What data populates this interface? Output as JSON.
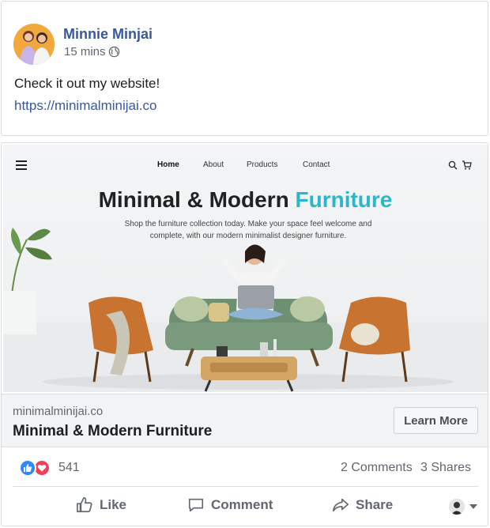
{
  "post": {
    "author": "Minnie Minjai",
    "time": "15 mins",
    "text": "Check it out my website!",
    "link": "https://minimalminijai.co"
  },
  "preview": {
    "nav": [
      "Home",
      "About",
      "Products",
      "Contact"
    ],
    "headline_main": "Minimal & Modern ",
    "headline_accent": "Furniture",
    "description": "Shop the furniture collection today. Make your space feel welcome and complete,  with our modern minimalist designer furniture.",
    "domain": "minimalminijai.co",
    "title": "Minimal & Modern Furniture",
    "cta": "Learn More"
  },
  "engagement": {
    "reaction_count": "541",
    "comments": "2 Comments",
    "shares": "3 Shares"
  },
  "actions": {
    "like": "Like",
    "comment": "Comment",
    "share": "Share"
  },
  "icons": {
    "privacy": "globe-icon",
    "like_reaction": "thumbs-up-icon",
    "love_reaction": "heart-icon"
  },
  "colors": {
    "name_blue": "#385898",
    "accent_teal": "#2bb7c9",
    "like_blue": "#2d88ff",
    "love_red": "#f33e58"
  }
}
